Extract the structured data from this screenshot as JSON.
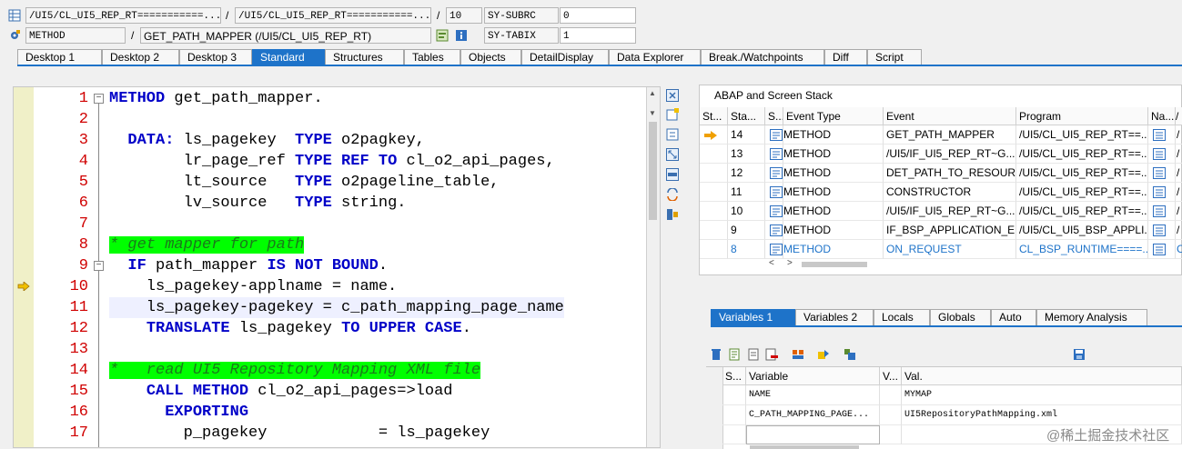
{
  "header": {
    "program_field": "/UI5/CL_UI5_REP_RT===========...",
    "include_field": "/UI5/CL_UI5_REP_RT===========...",
    "line_field": "10",
    "sy_subrc_label": "SY-SUBRC",
    "sy_subrc_value": "0",
    "event_type_field": "METHOD",
    "event_field": "GET_PATH_MAPPER (/UI5/CL_UI5_REP_RT)",
    "sy_tabix_label": "SY-TABIX",
    "sy_tabix_value": "1",
    "slash": "/"
  },
  "tabs": [
    "Desktop 1",
    "Desktop 2",
    "Desktop 3",
    "Standard",
    "Structures",
    "Tables",
    "Objects",
    "DetailDisplay",
    "Data Explorer",
    "Break./Watchpoints",
    "Diff",
    "Script"
  ],
  "active_tab": "Standard",
  "editor": {
    "line_numbers": [
      "1",
      "2",
      "3",
      "4",
      "5",
      "6",
      "7",
      "8",
      "9",
      "10",
      "11",
      "12",
      "13",
      "14",
      "15",
      "16",
      "17"
    ],
    "current_line": "10"
  },
  "stack": {
    "title": "ABAP and Screen Stack",
    "columns": [
      "St...",
      "Sta...",
      "S...",
      "Event Type",
      "Event",
      "Program",
      "Na...",
      "/"
    ],
    "rows": [
      {
        "level": "14",
        "type": "METHOD",
        "event": "GET_PATH_MAPPER",
        "program": "/UI5/CL_UI5_REP_RT==...",
        "nav": "/"
      },
      {
        "level": "13",
        "type": "METHOD",
        "event": "/UI5/IF_UI5_REP_RT~G...",
        "program": "/UI5/CL_UI5_REP_RT==...",
        "nav": "/"
      },
      {
        "level": "12",
        "type": "METHOD",
        "event": "DET_PATH_TO_RESOUR...",
        "program": "/UI5/CL_UI5_REP_RT==...",
        "nav": "/"
      },
      {
        "level": "11",
        "type": "METHOD",
        "event": "CONSTRUCTOR",
        "program": "/UI5/CL_UI5_REP_RT==...",
        "nav": "/"
      },
      {
        "level": "10",
        "type": "METHOD",
        "event": "/UI5/IF_UI5_REP_RT~G...",
        "program": "/UI5/CL_UI5_REP_RT==...",
        "nav": "/"
      },
      {
        "level": "9",
        "type": "METHOD",
        "event": "IF_BSP_APPLICATION_E...",
        "program": "/UI5/CL_UI5_BSP_APPLI...",
        "nav": "/"
      },
      {
        "level": "8",
        "type": "METHOD",
        "event": "ON_REQUEST",
        "program": "CL_BSP_RUNTIME====...",
        "nav": "C"
      }
    ]
  },
  "var_tabs": [
    "Variables 1",
    "Variables 2",
    "Locals",
    "Globals",
    "Auto",
    "Memory Analysis"
  ],
  "active_var_tab": "Variables 1",
  "variables": {
    "columns": [
      "S...",
      "Variable",
      "V...",
      "Val."
    ],
    "rows": [
      {
        "name": "NAME",
        "value": "MYMAP"
      },
      {
        "name": "C_PATH_MAPPING_PAGE...",
        "value": "UI5RepositoryPathMapping.xml"
      }
    ]
  },
  "watermark": "@稀土掘金技术社区",
  "colors": {
    "accent": "#1e73c9",
    "line_number": "#d00000",
    "keyword": "#0000c8",
    "comment_bg": "#00ff00"
  }
}
